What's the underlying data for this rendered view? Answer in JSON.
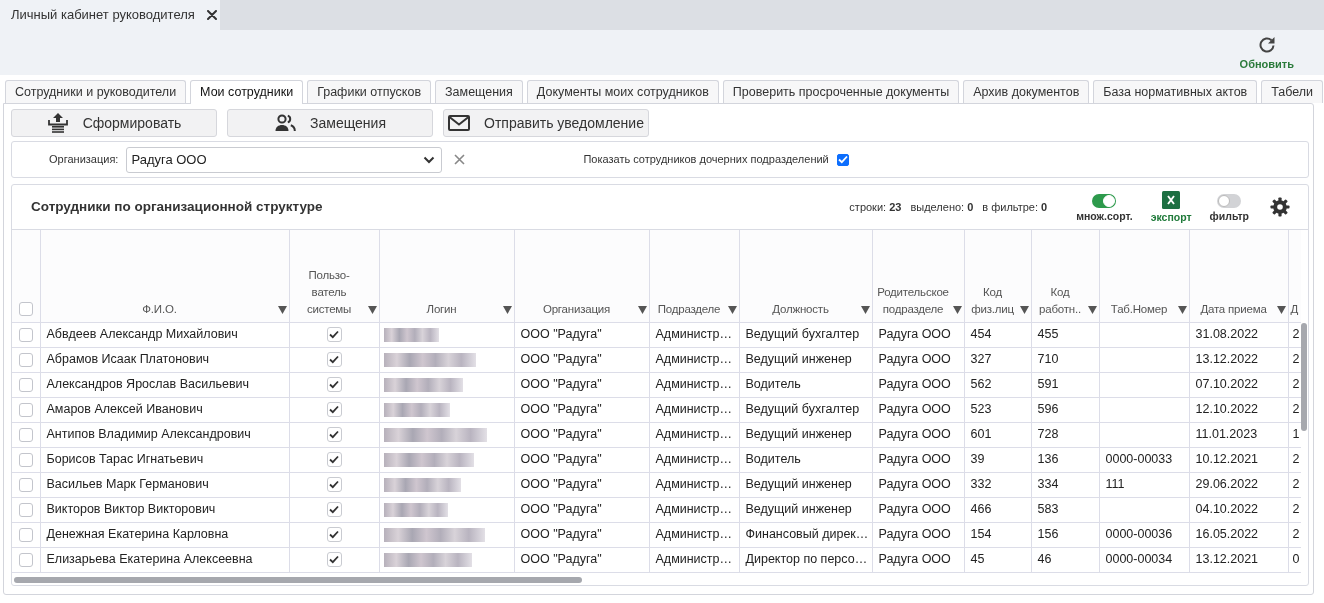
{
  "window_tabs": [
    {
      "label": "Личный кабинет руководителя",
      "selected": true
    }
  ],
  "toolbar": {
    "refresh_label": "Обновить"
  },
  "tabs": [
    {
      "label": "Сотрудники и руководители",
      "selected": false
    },
    {
      "label": "Мои сотрудники",
      "selected": true
    },
    {
      "label": "Графики отпусков",
      "selected": false
    },
    {
      "label": "Замещения",
      "selected": false
    },
    {
      "label": "Документы моих сотрудников",
      "selected": false
    },
    {
      "label": "Проверить просроченные документы",
      "selected": false
    },
    {
      "label": "Архив документов",
      "selected": false
    },
    {
      "label": "База нормативных актов",
      "selected": false
    },
    {
      "label": "Табели",
      "selected": false
    }
  ],
  "actions": [
    {
      "kind": "generate",
      "label": "Сформировать"
    },
    {
      "kind": "substitutions",
      "label": "Замещения"
    },
    {
      "kind": "notify",
      "label": "Отправить уведомление"
    }
  ],
  "filter": {
    "label": "Организация:",
    "organization": "Радуга ООО",
    "child_units": {
      "label": "Показать сотрудников дочерних подразделений",
      "checked": true
    }
  },
  "table": {
    "title": "Сотрудники по организационной структуре",
    "counters": [
      {
        "label": "строки:",
        "value": "23"
      },
      {
        "label": "выделено:",
        "value": "0"
      },
      {
        "label": "в фильтре:",
        "value": "0"
      }
    ],
    "tools": [
      {
        "kind": "switch",
        "label": "множ.сорт.",
        "on": true
      },
      {
        "kind": "export",
        "label": "экспорт"
      },
      {
        "kind": "switch",
        "label": "фильтр",
        "on": false
      },
      {
        "kind": "settings"
      }
    ],
    "select_all": {
      "checked": false
    },
    "columns": [
      {
        "kind": "text",
        "label": "Ф.И.О.",
        "sort_icon": true
      },
      {
        "kind": "check",
        "label": "Пользо-\nватель\nсистемы",
        "sort_icon": true
      },
      {
        "kind": "redacted",
        "label": "Логин",
        "sort_icon": true
      },
      {
        "kind": "text",
        "label": "Организация",
        "sort_icon": true
      },
      {
        "kind": "text",
        "label": "Подразделе",
        "sort_icon": true
      },
      {
        "kind": "text",
        "label": "Должность",
        "sort_icon": true
      },
      {
        "kind": "text",
        "label": "Родительское\nподразделе",
        "sort_icon": true
      },
      {
        "kind": "text",
        "label": "Код\nфиз.лиц",
        "sort_icon": true
      },
      {
        "kind": "text",
        "label": "Код\nработн..",
        "sort_icon": true
      },
      {
        "kind": "text",
        "label": "Таб.Номер",
        "sort_icon": true
      },
      {
        "kind": "text",
        "label": "Дата приема",
        "sort_icon": true
      },
      {
        "kind": "text",
        "label": "Д",
        "sort_icon": false
      }
    ],
    "rows": [
      {
        "selected": false,
        "system_user": true,
        "cells": [
          "Абвдеев Александр Михайлович",
          "",
          "",
          "ООО \"Радуга\"",
          "Администр…",
          "Ведущий бухгалтер",
          "Радуга ООО",
          "454",
          "455",
          "",
          "31.08.2022",
          "2"
        ]
      },
      {
        "selected": false,
        "system_user": true,
        "cells": [
          "Абрамов Исаак Платонович",
          "",
          "",
          "ООО \"Радуга\"",
          "Администр…",
          "Ведущий инженер",
          "Радуга ООО",
          "327",
          "710",
          "",
          "13.12.2022",
          "2"
        ]
      },
      {
        "selected": false,
        "system_user": true,
        "cells": [
          "Александров Ярослав Васильевич",
          "",
          "",
          "ООО \"Радуга\"",
          "Администр…",
          "Водитель",
          "Радуга ООО",
          "562",
          "591",
          "",
          "07.10.2022",
          "2"
        ]
      },
      {
        "selected": false,
        "system_user": true,
        "cells": [
          "Амаров Алексей Иванович",
          "",
          "",
          "ООО \"Радуга\"",
          "Администр…",
          "Ведущий бухгалтер",
          "Радуга ООО",
          "523",
          "596",
          "",
          "12.10.2022",
          "2"
        ]
      },
      {
        "selected": false,
        "system_user": true,
        "cells": [
          "Антипов Владимир Александрович",
          "",
          "",
          "ООО \"Радуга\"",
          "Администр…",
          "Ведущий инженер",
          "Радуга ООО",
          "601",
          "728",
          "",
          "11.01.2023",
          "1"
        ]
      },
      {
        "selected": false,
        "system_user": true,
        "cells": [
          "Борисов Тарас Игнатьевич",
          "",
          "",
          "ООО \"Радуга\"",
          "Администр…",
          "Водитель",
          "Радуга ООО",
          "39",
          "136",
          "0000-00033",
          "10.12.2021",
          "2"
        ]
      },
      {
        "selected": false,
        "system_user": true,
        "cells": [
          "Васильев Марк Германович",
          "",
          "",
          "ООО \"Радуга\"",
          "Администр…",
          "Ведущий инженер",
          "Радуга ООО",
          "332",
          "334",
          "111",
          "29.06.2022",
          "2"
        ]
      },
      {
        "selected": false,
        "system_user": true,
        "cells": [
          "Викторов Виктор Викторович",
          "",
          "",
          "ООО \"Радуга\"",
          "Администр…",
          "Ведущий инженер",
          "Радуга ООО",
          "466",
          "583",
          "",
          "04.10.2022",
          "2"
        ]
      },
      {
        "selected": false,
        "system_user": true,
        "cells": [
          "Денежная Екатерина Карловна",
          "",
          "",
          "ООО \"Радуга\"",
          "Администр…",
          "Финансовый дирек…",
          "Радуга ООО",
          "154",
          "156",
          "0000-00036",
          "16.05.2022",
          "2"
        ]
      },
      {
        "selected": false,
        "system_user": true,
        "cells": [
          "Елизарьева Екатерина Алексеевна",
          "",
          "",
          "ООО \"Радуга\"",
          "Администр…",
          "Директор по персо…",
          "Радуга ООО",
          "45",
          "46",
          "0000-00034",
          "13.12.2021",
          "0"
        ]
      }
    ]
  }
}
